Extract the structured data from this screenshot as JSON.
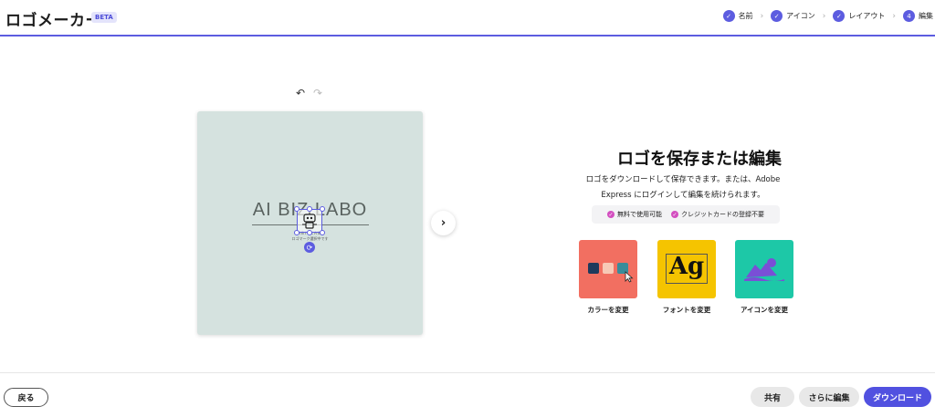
{
  "header": {
    "title": "ロゴメーカー",
    "badge": "BETA",
    "steps": [
      {
        "label": "名前",
        "marker": "✓"
      },
      {
        "label": "アイコン",
        "marker": "✓"
      },
      {
        "label": "レイアウト",
        "marker": "✓"
      },
      {
        "label": "編集",
        "marker": "4"
      }
    ]
  },
  "canvas": {
    "logo_text": "AI BIZ LABO",
    "tagline_1": "A I B I Z L A B O",
    "tagline_2": "ロゴマーク選択中です",
    "background_color": "#d5e2df"
  },
  "panel": {
    "title": "ロゴを保存または編集",
    "description": "ロゴをダウンロードして保存できます。または、Adobe Express にログインして編集を続けられます。",
    "perks": [
      "無料で使用可能",
      "クレジットカードの登録不要"
    ],
    "options": [
      {
        "label": "カラーを変更",
        "color": "#f26f61"
      },
      {
        "label": "フォントを変更",
        "color": "#f5c400",
        "sample": "Ag"
      },
      {
        "label": "アイコンを変更",
        "color": "#1dc8a7"
      }
    ]
  },
  "footer": {
    "back": "戻る",
    "share": "共有",
    "edit_more": "さらに編集",
    "download": "ダウンロード"
  },
  "colors": {
    "accent": "#5c5ce0",
    "primary_button": "#5151e0"
  }
}
